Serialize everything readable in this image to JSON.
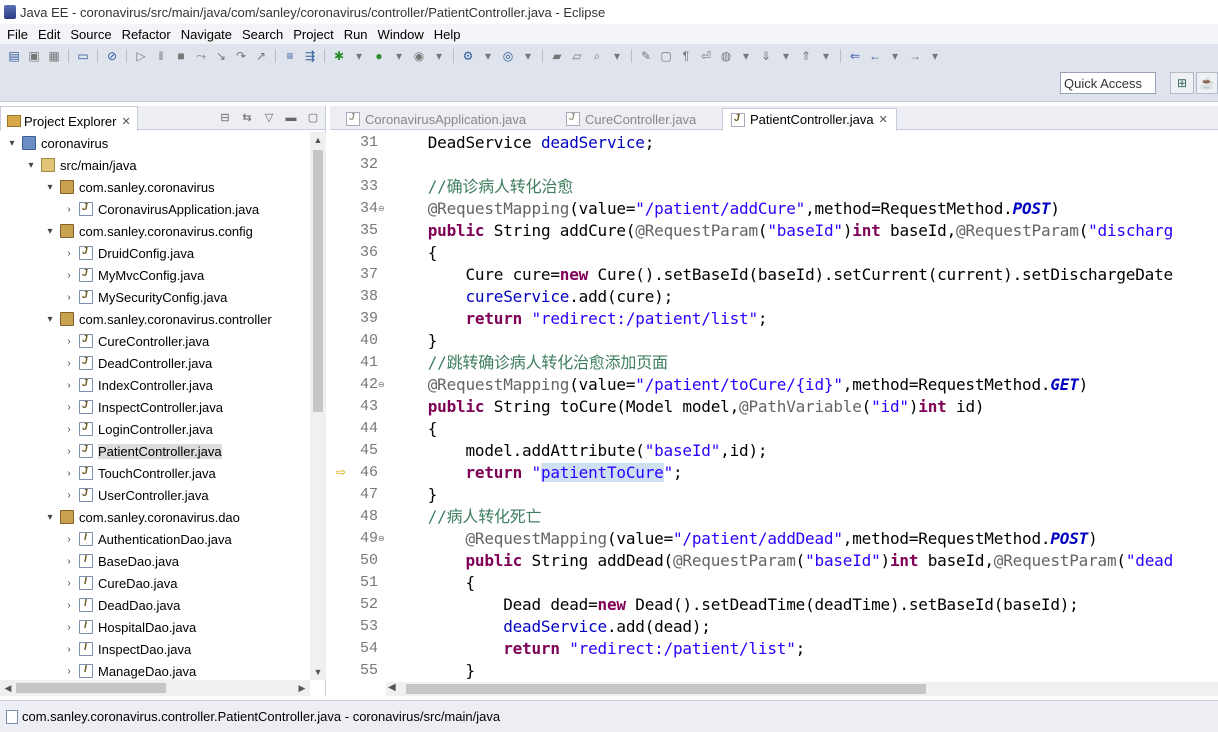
{
  "window": {
    "title": "Java EE - coronavirus/src/main/java/com/sanley/coronavirus/controller/PatientController.java - Eclipse"
  },
  "menu": [
    "File",
    "Edit",
    "Source",
    "Refactor",
    "Navigate",
    "Search",
    "Project",
    "Run",
    "Window",
    "Help"
  ],
  "toolbar": {
    "quick_access": "Quick Access"
  },
  "explorer": {
    "tab_label": "Project Explorer",
    "tree": [
      {
        "label": "coronavirus",
        "depth": 0,
        "arrow": "open",
        "icon": "project-icon"
      },
      {
        "label": "src/main/java",
        "depth": 1,
        "arrow": "open",
        "icon": "source-folder-icon"
      },
      {
        "label": "com.sanley.coronavirus",
        "depth": 2,
        "arrow": "open",
        "icon": "package-icon"
      },
      {
        "label": "CoronavirusApplication.java",
        "depth": 3,
        "arrow": "closed",
        "icon": "java-file-icon"
      },
      {
        "label": "com.sanley.coronavirus.config",
        "depth": 2,
        "arrow": "open",
        "icon": "package-icon"
      },
      {
        "label": "DruidConfig.java",
        "depth": 3,
        "arrow": "closed",
        "icon": "java-file-icon"
      },
      {
        "label": "MyMvcConfig.java",
        "depth": 3,
        "arrow": "closed",
        "icon": "java-file-icon"
      },
      {
        "label": "MySecurityConfig.java",
        "depth": 3,
        "arrow": "closed",
        "icon": "java-file-icon"
      },
      {
        "label": "com.sanley.coronavirus.controller",
        "depth": 2,
        "arrow": "open",
        "icon": "package-icon"
      },
      {
        "label": "CureController.java",
        "depth": 3,
        "arrow": "closed",
        "icon": "java-file-icon"
      },
      {
        "label": "DeadController.java",
        "depth": 3,
        "arrow": "closed",
        "icon": "java-file-icon"
      },
      {
        "label": "IndexController.java",
        "depth": 3,
        "arrow": "closed",
        "icon": "java-file-icon"
      },
      {
        "label": "InspectController.java",
        "depth": 3,
        "arrow": "closed",
        "icon": "java-file-icon"
      },
      {
        "label": "LoginController.java",
        "depth": 3,
        "arrow": "closed",
        "icon": "java-file-icon"
      },
      {
        "label": "PatientController.java",
        "depth": 3,
        "arrow": "closed",
        "icon": "java-file-icon",
        "selected": true
      },
      {
        "label": "TouchController.java",
        "depth": 3,
        "arrow": "closed",
        "icon": "java-file-icon"
      },
      {
        "label": "UserController.java",
        "depth": 3,
        "arrow": "closed",
        "icon": "java-file-icon"
      },
      {
        "label": "com.sanley.coronavirus.dao",
        "depth": 2,
        "arrow": "open",
        "icon": "package-icon"
      },
      {
        "label": "AuthenticationDao.java",
        "depth": 3,
        "arrow": "closed",
        "icon": "interface-file-icon"
      },
      {
        "label": "BaseDao.java",
        "depth": 3,
        "arrow": "closed",
        "icon": "interface-file-icon"
      },
      {
        "label": "CureDao.java",
        "depth": 3,
        "arrow": "closed",
        "icon": "interface-file-icon"
      },
      {
        "label": "DeadDao.java",
        "depth": 3,
        "arrow": "closed",
        "icon": "interface-file-icon"
      },
      {
        "label": "HospitalDao.java",
        "depth": 3,
        "arrow": "closed",
        "icon": "interface-file-icon"
      },
      {
        "label": "InspectDao.java",
        "depth": 3,
        "arrow": "closed",
        "icon": "interface-file-icon"
      },
      {
        "label": "ManageDao.java",
        "depth": 3,
        "arrow": "closed",
        "icon": "interface-file-icon"
      }
    ]
  },
  "editor": {
    "tabs": [
      {
        "label": "CoronavirusApplication.java",
        "active": false
      },
      {
        "label": "CureController.java",
        "active": false
      },
      {
        "label": "PatientController.java",
        "active": true
      }
    ],
    "lines": [
      {
        "n": "31",
        "tokens": [
          [
            "",
            "    DeadService "
          ],
          [
            "fld",
            "deadService"
          ],
          [
            "",
            ";"
          ]
        ]
      },
      {
        "n": "32",
        "tokens": []
      },
      {
        "n": "33",
        "tokens": [
          [
            "cm",
            "    //确诊病人转化治愈"
          ]
        ]
      },
      {
        "n": "34",
        "fold": true,
        "tokens": [
          [
            "ann",
            "    @RequestMapping"
          ],
          [
            "",
            "(value="
          ],
          [
            "str",
            "\"/patient/addCure\""
          ],
          [
            "",
            ",method=RequestMethod."
          ],
          [
            "itl",
            "POST"
          ],
          [
            "",
            ")"
          ]
        ]
      },
      {
        "n": "35",
        "tokens": [
          [
            "kw",
            "    public"
          ],
          [
            "",
            " String addCure("
          ],
          [
            "ann",
            "@RequestParam"
          ],
          [
            "",
            "("
          ],
          [
            "str",
            "\"baseId\""
          ],
          [
            "",
            ")"
          ],
          [
            "kw",
            "int"
          ],
          [
            "",
            " baseId,"
          ],
          [
            "ann",
            "@RequestParam"
          ],
          [
            "",
            "("
          ],
          [
            "str",
            "\"discharg"
          ]
        ]
      },
      {
        "n": "36",
        "tokens": [
          [
            "",
            "    {"
          ]
        ]
      },
      {
        "n": "37",
        "tokens": [
          [
            "",
            "        Cure cure="
          ],
          [
            "kw",
            "new"
          ],
          [
            "",
            " Cure().setBaseId(baseId).setCurrent(current).setDischargeDate"
          ]
        ]
      },
      {
        "n": "38",
        "tokens": [
          [
            "fld",
            "        cureService"
          ],
          [
            "",
            ".add(cure);"
          ]
        ]
      },
      {
        "n": "39",
        "tokens": [
          [
            "kw",
            "        return"
          ],
          [
            "",
            " "
          ],
          [
            "str",
            "\"redirect:/patient/list\""
          ],
          [
            "",
            ";"
          ]
        ]
      },
      {
        "n": "40",
        "tokens": [
          [
            "",
            "    }"
          ]
        ]
      },
      {
        "n": "41",
        "tokens": [
          [
            "cm",
            "    //跳转确诊病人转化治愈添加页面"
          ]
        ]
      },
      {
        "n": "42",
        "fold": true,
        "tokens": [
          [
            "ann",
            "    @RequestMapping"
          ],
          [
            "",
            "(value="
          ],
          [
            "str",
            "\"/patient/toCure/{id}\""
          ],
          [
            "",
            ",method=RequestMethod."
          ],
          [
            "itl",
            "GET"
          ],
          [
            "",
            ")"
          ]
        ]
      },
      {
        "n": "43",
        "tokens": [
          [
            "kw",
            "    public"
          ],
          [
            "",
            " String toCure(Model model,"
          ],
          [
            "ann",
            "@PathVariable"
          ],
          [
            "",
            "("
          ],
          [
            "str",
            "\"id\""
          ],
          [
            "",
            ")"
          ],
          [
            "kw",
            "int"
          ],
          [
            "",
            " id)"
          ]
        ]
      },
      {
        "n": "44",
        "tokens": [
          [
            "",
            "    {"
          ]
        ]
      },
      {
        "n": "45",
        "tokens": [
          [
            "",
            "        model.addAttribute("
          ],
          [
            "str",
            "\"baseId\""
          ],
          [
            "",
            ",id);"
          ]
        ]
      },
      {
        "n": "46",
        "marker": true,
        "tokens": [
          [
            "kw",
            "        return"
          ],
          [
            "",
            " "
          ],
          [
            "str",
            "\""
          ],
          [
            "hl",
            "patientToCure"
          ],
          [
            "str",
            "\""
          ],
          [
            "",
            ";"
          ]
        ]
      },
      {
        "n": "47",
        "tokens": [
          [
            "",
            "    }"
          ]
        ]
      },
      {
        "n": "48",
        "tokens": [
          [
            "cm",
            "    //病人转化死亡"
          ]
        ]
      },
      {
        "n": "49",
        "fold": true,
        "tokens": [
          [
            "ann",
            "        @RequestMapping"
          ],
          [
            "",
            "(value="
          ],
          [
            "str",
            "\"/patient/addDead\""
          ],
          [
            "",
            ",method=RequestMethod."
          ],
          [
            "itl",
            "POST"
          ],
          [
            "",
            ")"
          ]
        ]
      },
      {
        "n": "50",
        "tokens": [
          [
            "kw",
            "        public"
          ],
          [
            "",
            " String addDead("
          ],
          [
            "ann",
            "@RequestParam"
          ],
          [
            "",
            "("
          ],
          [
            "str",
            "\"baseId\""
          ],
          [
            "",
            ")"
          ],
          [
            "kw",
            "int"
          ],
          [
            "",
            " baseId,"
          ],
          [
            "ann",
            "@RequestParam"
          ],
          [
            "",
            "("
          ],
          [
            "str",
            "\"dead"
          ]
        ]
      },
      {
        "n": "51",
        "tokens": [
          [
            "",
            "        {"
          ]
        ]
      },
      {
        "n": "52",
        "tokens": [
          [
            "",
            "            Dead dead="
          ],
          [
            "kw",
            "new"
          ],
          [
            "",
            " Dead().setDeadTime(deadTime).setBaseId(baseId);"
          ]
        ]
      },
      {
        "n": "53",
        "tokens": [
          [
            "fld",
            "            deadService"
          ],
          [
            "",
            ".add(dead);"
          ]
        ]
      },
      {
        "n": "54",
        "tokens": [
          [
            "kw",
            "            return"
          ],
          [
            "",
            " "
          ],
          [
            "str",
            "\"redirect:/patient/list\""
          ],
          [
            "",
            ";"
          ]
        ]
      },
      {
        "n": "55",
        "tokens": [
          [
            "",
            "        }"
          ]
        ]
      }
    ]
  },
  "status": {
    "text": "com.sanley.coronavirus.controller.PatientController.java - coronavirus/src/main/java"
  }
}
